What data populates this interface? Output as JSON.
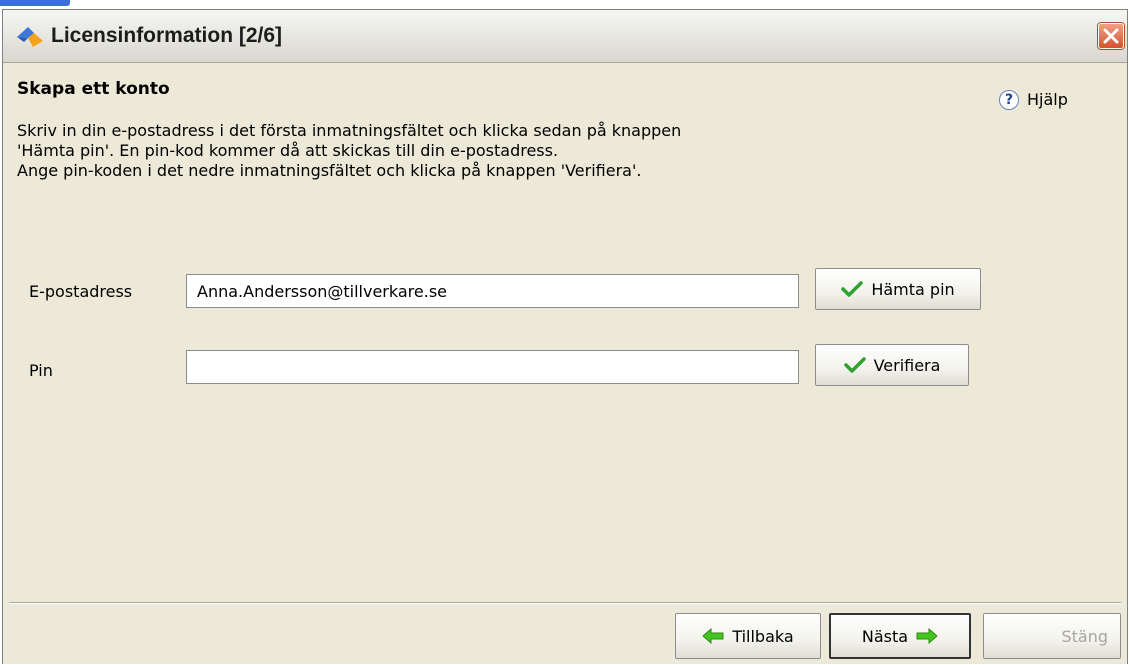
{
  "window": {
    "title": "Licensinformation [2/6]"
  },
  "page": {
    "heading": "Skapa ett konto",
    "help_label": "Hjälp",
    "instructions": [
      "Skriv in din e-postadress i det första inmatningsfältet och klicka sedan på knappen",
      "'Hämta pin'. En pin-kod kommer då att skickas till din e-postadress.",
      "Ange pin-koden i det nedre inmatningsfältet och klicka på knappen 'Verifiera'."
    ]
  },
  "form": {
    "email_label": "E-postadress",
    "email_value": "Anna.Andersson@tillverkare.se",
    "email_placeholder": "",
    "get_pin_button": "Hämta pin",
    "pin_label": "Pin",
    "pin_value": "",
    "verify_button": "Verifiera"
  },
  "footer": {
    "back_button": "Tillbaka",
    "next_button": "Nästa",
    "close_button": "Stäng",
    "close_disabled": true
  },
  "icons": {
    "app": "app-logo-icon",
    "close": "close-x-icon",
    "help": "question-mark-icon",
    "check": "checkmark-icon",
    "back": "arrow-left-icon",
    "next": "arrow-right-icon"
  },
  "colors": {
    "window_bg": "#ece9d8",
    "check_green": "#2fa12f",
    "arrow_green": "#44c41e",
    "close_red": "#d6512f",
    "disabled_text": "#a7a69f"
  }
}
